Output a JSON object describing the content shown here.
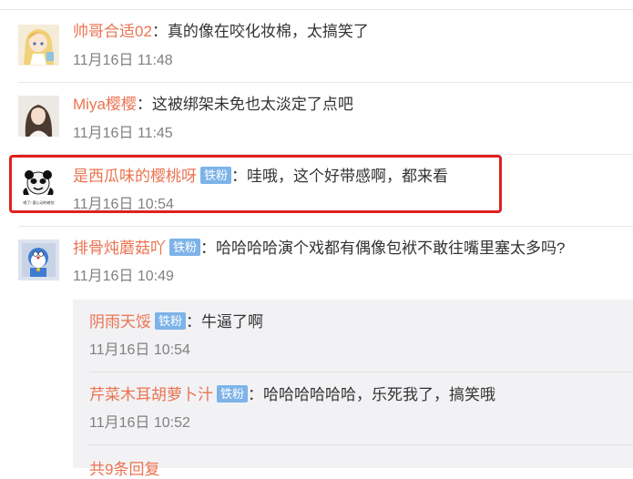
{
  "comments": [
    {
      "username": "帅哥合适02",
      "badge": "",
      "text": "真的像在咬化妆棉，太搞笑了",
      "time": "11月16日 11:48"
    },
    {
      "username": "Miya樱樱",
      "badge": "",
      "text": "这被绑架未免也太淡定了点吧",
      "time": "11月16日 11:45"
    },
    {
      "username": "是西瓜味的樱桃呀",
      "badge": "铁粉",
      "text": "哇哦，这个好带感啊，都来看",
      "time": "11月16日 10:54",
      "avatar_caption": "嗝了!  要心动的感觉"
    },
    {
      "username": "排骨炖蘑菇吖",
      "badge": "铁粉",
      "text": "哈哈哈哈演个戏都有偶像包袱不敢往嘴里塞太多吗?",
      "time": "11月16日 10:49"
    }
  ],
  "replies": [
    {
      "username": "阴雨天馁",
      "badge": "铁粉",
      "text": "牛逼了啊",
      "time": "11月16日 10:54"
    },
    {
      "username": "芹菜木耳胡萝卜汁",
      "badge": "铁粉",
      "text": "哈哈哈哈哈哈，乐死我了，搞笑哦",
      "time": "11月16日 10:52"
    }
  ],
  "more_replies": "共9条回复",
  "colon": "：",
  "colors": {
    "username": "#eb7350",
    "badge_bg": "#7db3e8",
    "highlight_border": "#e02020",
    "reply_bg": "#f2f2f5"
  }
}
